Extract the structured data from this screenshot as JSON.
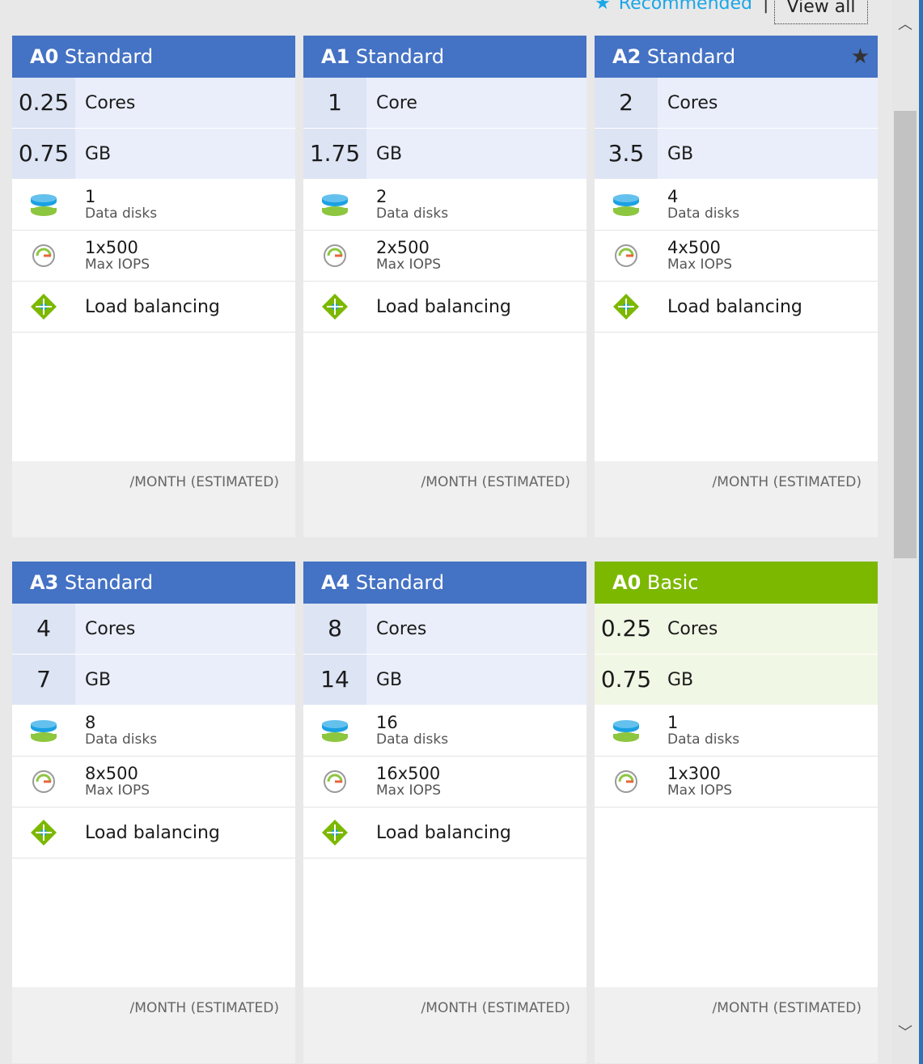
{
  "toolbar": {
    "recommended_label": "Recommended",
    "separator": "|",
    "view_all_label": "View all",
    "accent_color": "#1aa7e8"
  },
  "colors": {
    "standard_header": "#4472c4",
    "basic_header": "#7cb800"
  },
  "cards": [
    {
      "tier_code": "A0",
      "tier_name": "Standard",
      "recommended": false,
      "cores_value": "0.25",
      "cores_unit": "Cores",
      "memory_value": "0.75",
      "memory_unit": "GB",
      "disks_value": "1",
      "disks_label": "Data disks",
      "iops_value": "1x500",
      "iops_label": "Max IOPS",
      "feature_label": "Load balancing",
      "price_label": "/MONTH (ESTIMATED)"
    },
    {
      "tier_code": "A1",
      "tier_name": "Standard",
      "recommended": false,
      "cores_value": "1",
      "cores_unit": "Core",
      "memory_value": "1.75",
      "memory_unit": "GB",
      "disks_value": "2",
      "disks_label": "Data disks",
      "iops_value": "2x500",
      "iops_label": "Max IOPS",
      "feature_label": "Load balancing",
      "price_label": "/MONTH (ESTIMATED)"
    },
    {
      "tier_code": "A2",
      "tier_name": "Standard",
      "recommended": true,
      "cores_value": "2",
      "cores_unit": "Cores",
      "memory_value": "3.5",
      "memory_unit": "GB",
      "disks_value": "4",
      "disks_label": "Data disks",
      "iops_value": "4x500",
      "iops_label": "Max IOPS",
      "feature_label": "Load balancing",
      "price_label": "/MONTH (ESTIMATED)"
    },
    {
      "tier_code": "A3",
      "tier_name": "Standard",
      "recommended": false,
      "cores_value": "4",
      "cores_unit": "Cores",
      "memory_value": "7",
      "memory_unit": "GB",
      "disks_value": "8",
      "disks_label": "Data disks",
      "iops_value": "8x500",
      "iops_label": "Max IOPS",
      "feature_label": "Load balancing",
      "price_label": "/MONTH (ESTIMATED)"
    },
    {
      "tier_code": "A4",
      "tier_name": "Standard",
      "recommended": false,
      "cores_value": "8",
      "cores_unit": "Cores",
      "memory_value": "14",
      "memory_unit": "GB",
      "disks_value": "16",
      "disks_label": "Data disks",
      "iops_value": "16x500",
      "iops_label": "Max IOPS",
      "feature_label": "Load balancing",
      "price_label": "/MONTH (ESTIMATED)"
    },
    {
      "tier_code": "A0",
      "tier_name": "Basic",
      "recommended": false,
      "cores_value": "0.25",
      "cores_unit": "Cores",
      "memory_value": "0.75",
      "memory_unit": "GB",
      "disks_value": "1",
      "disks_label": "Data disks",
      "iops_value": "1x300",
      "iops_label": "Max IOPS",
      "feature_label": "",
      "price_label": "/MONTH (ESTIMATED)"
    }
  ]
}
